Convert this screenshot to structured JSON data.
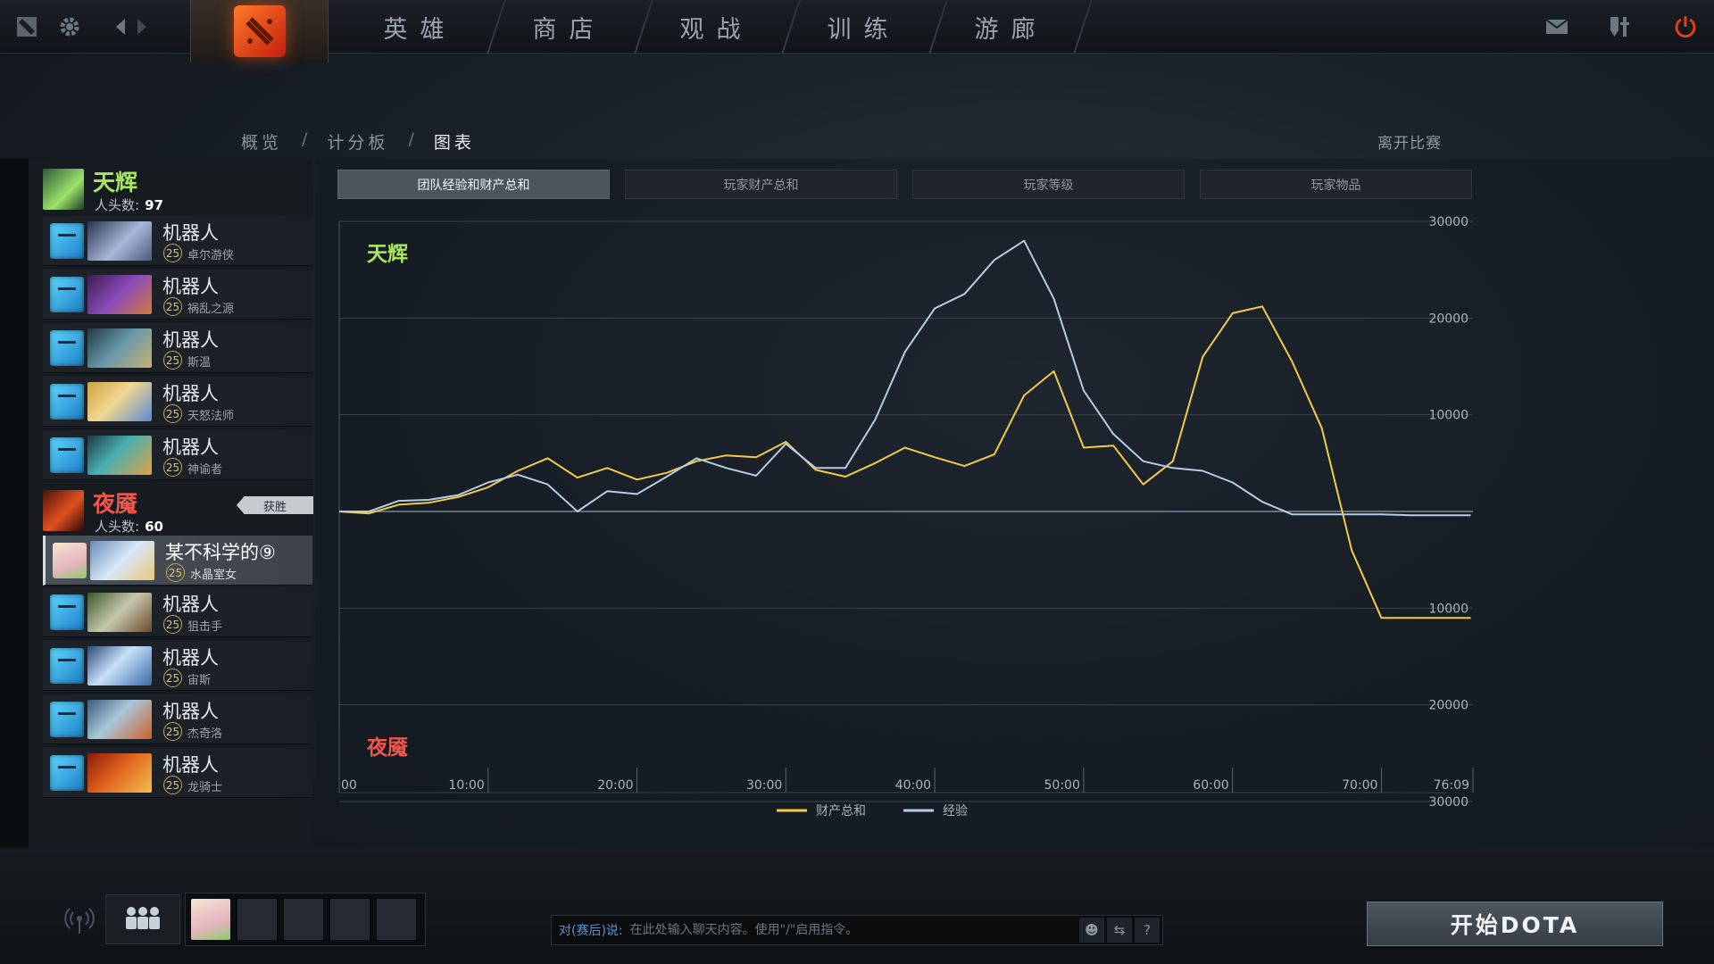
{
  "topbar": {
    "nav": [
      "英雄",
      "商店",
      "观战",
      "训练",
      "游廊"
    ]
  },
  "breadcrumb": {
    "items": [
      "概览",
      "计分板",
      "图表"
    ],
    "separator": "/",
    "active_index": 2
  },
  "leave_match_label": "离开比赛",
  "teams": {
    "radiant": {
      "name": "天辉",
      "kills_label": "人头数:",
      "kills": "97",
      "color": "#a9e85c",
      "players": [
        {
          "name": "机器人",
          "level": "25",
          "hero": "卓尔游侠",
          "bot": true
        },
        {
          "name": "机器人",
          "level": "25",
          "hero": "祸乱之源",
          "bot": true
        },
        {
          "name": "机器人",
          "level": "25",
          "hero": "斯温",
          "bot": true
        },
        {
          "name": "机器人",
          "level": "25",
          "hero": "天怒法师",
          "bot": true
        },
        {
          "name": "机器人",
          "level": "25",
          "hero": "神谕者",
          "bot": true
        }
      ]
    },
    "dire": {
      "name": "夜魇",
      "kills_label": "人头数:",
      "kills": "60",
      "color": "#f0564a",
      "win_badge": "获胜",
      "players": [
        {
          "name": "某不科学的⑨",
          "level": "25",
          "hero": "水晶室女",
          "bot": false,
          "self": true
        },
        {
          "name": "机器人",
          "level": "25",
          "hero": "狙击手",
          "bot": true
        },
        {
          "name": "机器人",
          "level": "25",
          "hero": "宙斯",
          "bot": true
        },
        {
          "name": "机器人",
          "level": "25",
          "hero": "杰奇洛",
          "bot": true
        },
        {
          "name": "机器人",
          "level": "25",
          "hero": "龙骑士",
          "bot": true
        }
      ]
    }
  },
  "chart_tabs": [
    "团队经验和财产总和",
    "玩家财产总和",
    "玩家等级",
    "玩家物品"
  ],
  "active_chart_tab": 0,
  "chart_side_labels": {
    "top": "天辉",
    "bottom": "夜魇"
  },
  "chart_data": {
    "type": "line",
    "x_label_first": "00",
    "x_ticks": [
      "10:00",
      "20:00",
      "30:00",
      "40:00",
      "50:00",
      "60:00",
      "70:00",
      "76:09"
    ],
    "x_tick_minutes": [
      10,
      20,
      30,
      40,
      50,
      60,
      70,
      76.15
    ],
    "xlim": [
      0,
      76.15
    ],
    "y_ticks": [
      30000,
      20000,
      10000,
      0,
      -10000,
      -20000,
      -30000
    ],
    "y_tick_labels": [
      "30000",
      "20000",
      "10000",
      "",
      "10000",
      "20000",
      "30000"
    ],
    "ylim": [
      -30000,
      30000
    ],
    "grid": true,
    "legend_position": "bottom-center",
    "series": [
      {
        "name": "财产总和",
        "color": "#f2cc45",
        "x": [
          0,
          2,
          4,
          6,
          8,
          10,
          12,
          14,
          16,
          18,
          20,
          22,
          24,
          26,
          28,
          30,
          32,
          34,
          36,
          38,
          40,
          42,
          44,
          46,
          48,
          50,
          52,
          54,
          56,
          58,
          60,
          62,
          64,
          66,
          68,
          70,
          72,
          74,
          76
        ],
        "y": [
          0,
          -200,
          700,
          900,
          1500,
          2500,
          4200,
          5500,
          3500,
          4500,
          3300,
          4000,
          5200,
          5800,
          5600,
          7200,
          4300,
          3600,
          5000,
          6600,
          5600,
          4700,
          5900,
          12000,
          14500,
          6600,
          6800,
          2800,
          5200,
          16000,
          20500,
          21200,
          15500,
          8600,
          -4000,
          -11000,
          -11000,
          -11000,
          -11000
        ]
      },
      {
        "name": "经验",
        "color": "#b6cbe6",
        "x": [
          0,
          2,
          4,
          6,
          8,
          10,
          12,
          14,
          16,
          18,
          20,
          22,
          24,
          26,
          28,
          30,
          32,
          34,
          36,
          38,
          40,
          42,
          44,
          46,
          48,
          50,
          52,
          54,
          56,
          58,
          60,
          62,
          64,
          66,
          68,
          70,
          72,
          74,
          76
        ],
        "y": [
          0,
          0,
          1100,
          1200,
          1700,
          3000,
          3800,
          2800,
          0,
          2100,
          1800,
          3600,
          5500,
          4500,
          3700,
          7000,
          4500,
          4500,
          9500,
          16500,
          21000,
          22500,
          26000,
          28000,
          22000,
          12500,
          8000,
          5200,
          4500,
          4200,
          3000,
          1000,
          -300,
          -300,
          -300,
          -300,
          -400,
          -400,
          -400
        ]
      }
    ]
  },
  "chat": {
    "target": "对(赛后)说:",
    "placeholder": "在此处输入聊天内容。使用\"/\"启用指令。"
  },
  "play_button_label": "开始DOTA",
  "colors": {
    "accent": "#f2cc45",
    "xp_line": "#b6cbe6",
    "radiant": "#a9e85c",
    "dire": "#f0564a"
  }
}
